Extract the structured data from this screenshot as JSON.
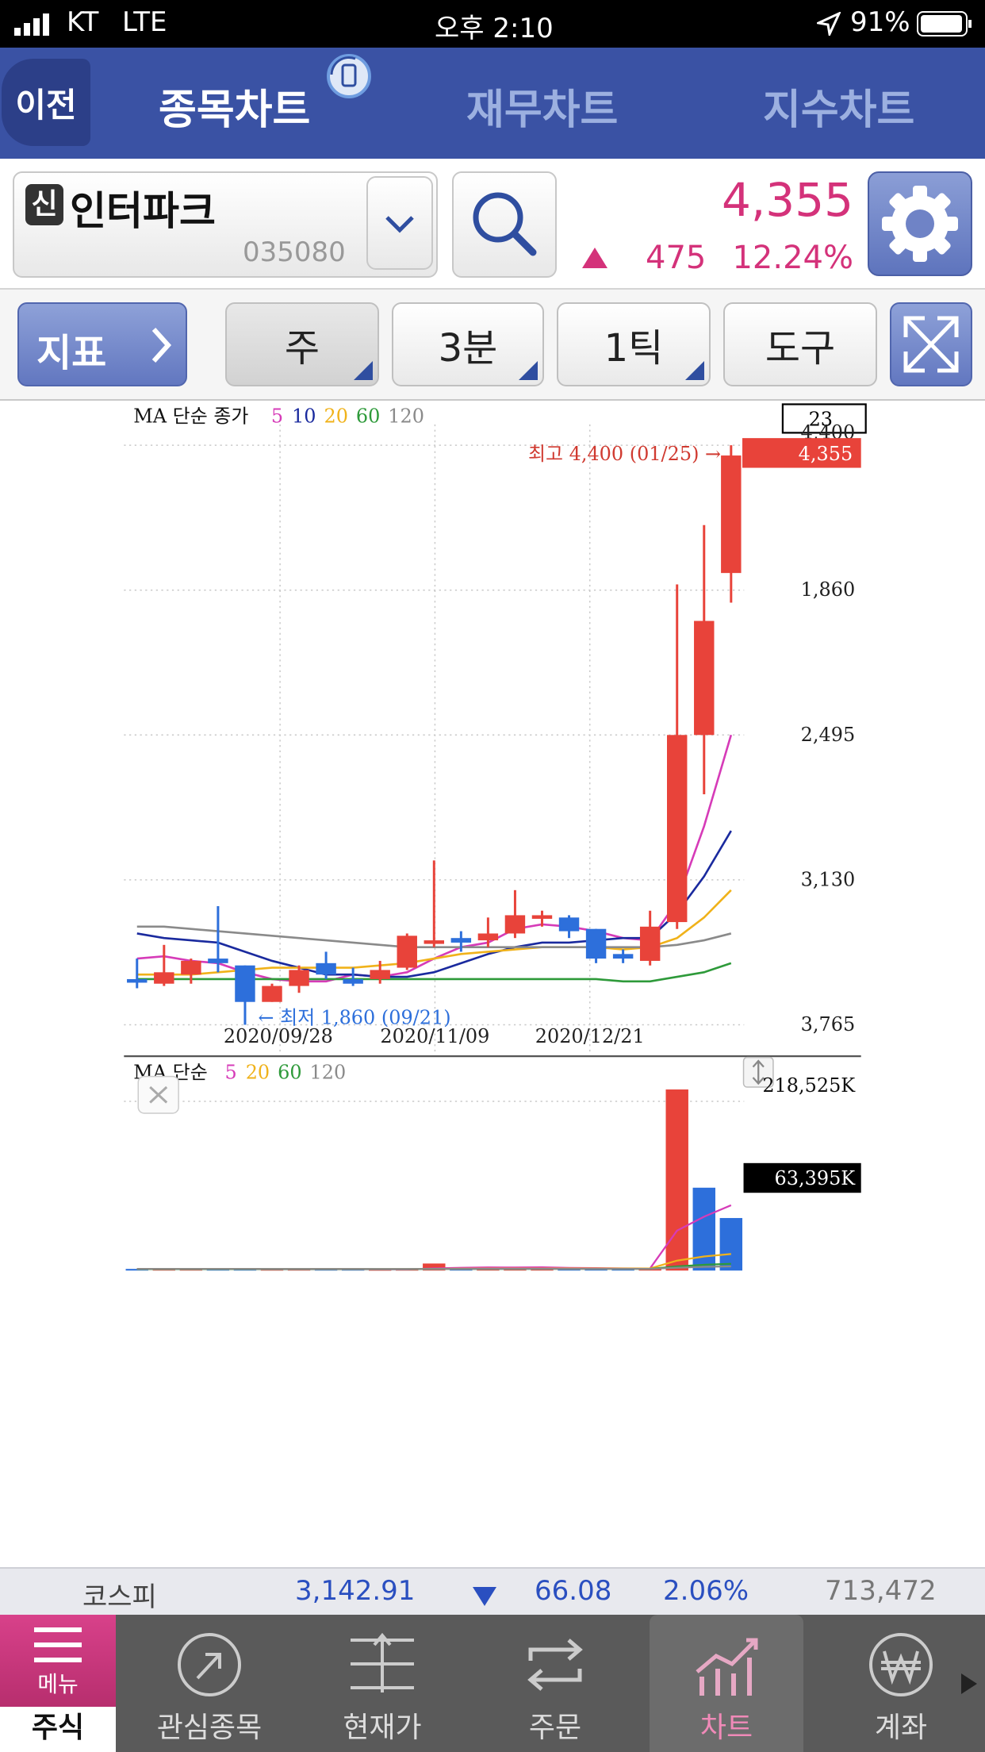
{
  "status": {
    "carrier": "KT",
    "network": "LTE",
    "time": "오후 2:10",
    "battery": "91%"
  },
  "nav": {
    "back": "이전",
    "tabs": [
      "종목차트",
      "재무차트",
      "지수차트"
    ]
  },
  "stock": {
    "badge": "신",
    "name": "인터파크",
    "code": "035080",
    "price": "4,355",
    "change": "475",
    "rate": "12.24%"
  },
  "toolbar": {
    "indicator": "지표",
    "period": "주",
    "interval": "3분",
    "tick": "1틱",
    "tools": "도구"
  },
  "price_chart": {
    "legend_title": "MA 단순 종가",
    "ma_periods": [
      "5",
      "10",
      "20",
      "60",
      "120"
    ],
    "ma_colors": [
      "#d63bb8",
      "#1a2a9e",
      "#f0b21a",
      "#2e9a3a",
      "#8a8a8a"
    ],
    "count_box": "23",
    "current_price_label": "4,355",
    "high_label": "최고 4,400 (01/25) →",
    "low_label": "← 최저 1,860 (09/21)",
    "y_ticks": [
      "3,765",
      "3,130",
      "2,495",
      "1,860"
    ],
    "y_top_partial": "4,400",
    "x_ticks": [
      "2020/09/28",
      "2020/11/09",
      "2020/12/21"
    ]
  },
  "volume_chart": {
    "legend_title": "MA 단순",
    "ma_periods": [
      "5",
      "20",
      "60",
      "120"
    ],
    "ma_colors": [
      "#d63bb8",
      "#f0b21a",
      "#2e9a3a",
      "#8a8a8a"
    ],
    "max_label": "218,525K",
    "current_label": "63,395K"
  },
  "chart_data": [
    {
      "type": "candlestick",
      "title": "",
      "ylim": [
        1860,
        4400
      ],
      "y_ticks": [
        1860,
        2495,
        3130,
        3765
      ],
      "x_ticks": [
        "2020/09/28",
        "2020/11/09",
        "2020/12/21"
      ],
      "candles": [
        {
          "o": 2060,
          "h": 2150,
          "l": 2020,
          "c": 2050
        },
        {
          "o": 2040,
          "h": 2210,
          "l": 2030,
          "c": 2090
        },
        {
          "o": 2080,
          "h": 2150,
          "l": 2040,
          "c": 2140
        },
        {
          "o": 2150,
          "h": 2380,
          "l": 2090,
          "c": 2130
        },
        {
          "o": 2120,
          "h": 2120,
          "l": 1860,
          "c": 1960
        },
        {
          "o": 1960,
          "h": 2040,
          "l": 1960,
          "c": 2030
        },
        {
          "o": 2030,
          "h": 2120,
          "l": 2000,
          "c": 2100
        },
        {
          "o": 2130,
          "h": 2180,
          "l": 2060,
          "c": 2080
        },
        {
          "o": 2060,
          "h": 2110,
          "l": 2030,
          "c": 2040
        },
        {
          "o": 2060,
          "h": 2140,
          "l": 2040,
          "c": 2100
        },
        {
          "o": 2110,
          "h": 2260,
          "l": 2100,
          "c": 2250
        },
        {
          "o": 2230,
          "h": 2580,
          "l": 2200,
          "c": 2230
        },
        {
          "o": 2240,
          "h": 2270,
          "l": 2180,
          "c": 2220
        },
        {
          "o": 2230,
          "h": 2330,
          "l": 2200,
          "c": 2260
        },
        {
          "o": 2260,
          "h": 2450,
          "l": 2240,
          "c": 2340
        },
        {
          "o": 2330,
          "h": 2360,
          "l": 2290,
          "c": 2340
        },
        {
          "o": 2330,
          "h": 2340,
          "l": 2240,
          "c": 2270
        },
        {
          "o": 2280,
          "h": 2280,
          "l": 2130,
          "c": 2150
        },
        {
          "o": 2170,
          "h": 2190,
          "l": 2130,
          "c": 2150
        },
        {
          "o": 2140,
          "h": 2360,
          "l": 2120,
          "c": 2290
        },
        {
          "o": 2310,
          "h": 3790,
          "l": 2280,
          "c": 3130
        },
        {
          "o": 3130,
          "h": 4050,
          "l": 2870,
          "c": 3630
        },
        {
          "o": 3840,
          "h": 4400,
          "l": 3710,
          "c": 4355
        }
      ],
      "ma": {
        "5": [
          2150,
          2160,
          2140,
          2130,
          2090,
          2060,
          2050,
          2050,
          2080,
          2070,
          2090,
          2150,
          2200,
          2220,
          2280,
          2300,
          2290,
          2270,
          2240,
          2230,
          2400,
          2730,
          3130
        ],
        "10": [
          2260,
          2240,
          2230,
          2220,
          2180,
          2140,
          2110,
          2080,
          2080,
          2070,
          2070,
          2090,
          2130,
          2170,
          2200,
          2220,
          2220,
          2230,
          2240,
          2240,
          2350,
          2510,
          2710
        ],
        "20": [
          2080,
          2080,
          2080,
          2090,
          2100,
          2110,
          2110,
          2110,
          2110,
          2120,
          2130,
          2150,
          2170,
          2180,
          2190,
          2200,
          2200,
          2200,
          2190,
          2200,
          2240,
          2330,
          2450
        ],
        "60": [
          2060,
          2060,
          2060,
          2060,
          2060,
          2060,
          2060,
          2060,
          2060,
          2060,
          2060,
          2060,
          2060,
          2060,
          2060,
          2060,
          2060,
          2060,
          2050,
          2050,
          2070,
          2090,
          2130
        ],
        "120": [
          2290,
          2290,
          2280,
          2270,
          2260,
          2250,
          2240,
          2230,
          2220,
          2210,
          2200,
          2200,
          2200,
          2200,
          2200,
          2200,
          2200,
          2200,
          2200,
          2200,
          2210,
          2230,
          2260
        ]
      }
    },
    {
      "type": "bar",
      "title": "",
      "unit": "K",
      "values": [
        2000,
        1800,
        1500,
        1600,
        2200,
        1400,
        1600,
        1800,
        1500,
        1300,
        1400,
        8500,
        4000,
        3500,
        3000,
        2800,
        2500,
        2000,
        2200,
        2600,
        218525,
        100000,
        63395
      ],
      "up": [
        false,
        true,
        true,
        false,
        false,
        true,
        true,
        false,
        false,
        true,
        true,
        true,
        false,
        true,
        true,
        true,
        false,
        false,
        false,
        true,
        true,
        false,
        false
      ],
      "ma": {
        "5": [
          1900,
          1850,
          1800,
          1750,
          1800,
          1700,
          1660,
          1720,
          1700,
          1520,
          1440,
          2640,
          3400,
          3800,
          3750,
          3950,
          3250,
          3000,
          2650,
          2560,
          48250,
          65030,
          78820
        ],
        "20": [
          1800,
          1800,
          1800,
          1800,
          1800,
          1800,
          1800,
          1800,
          1800,
          1780,
          1760,
          2100,
          2250,
          2350,
          2400,
          2450,
          2500,
          2520,
          2540,
          2560,
          12000,
          17000,
          20000
        ],
        "60": [
          1700,
          1700,
          1700,
          1700,
          1700,
          1700,
          1700,
          1700,
          1700,
          1700,
          1700,
          1800,
          1850,
          1900,
          1950,
          2000,
          2000,
          2050,
          2050,
          2050,
          5000,
          7000,
          8200
        ],
        "120": [
          1900,
          1900,
          1900,
          1900,
          1900,
          1900,
          1900,
          1900,
          1900,
          1900,
          1900,
          1950,
          1980,
          2000,
          2020,
          2050,
          2050,
          2050,
          2060,
          2060,
          3500,
          4500,
          5000
        ]
      }
    }
  ],
  "kospi": {
    "label": "코스피",
    "value": "3,142.91",
    "change": "66.08",
    "rate": "2.06%",
    "volume": "713,472"
  },
  "tabbar": {
    "menu": "메뉴",
    "items": [
      "주식",
      "관심종목",
      "현재가",
      "주문",
      "차트",
      "계좌"
    ]
  },
  "colors": {
    "up": "#e8433a",
    "down": "#2d6fdb",
    "nav": "#3a52a4",
    "accent": "#d4327a"
  }
}
